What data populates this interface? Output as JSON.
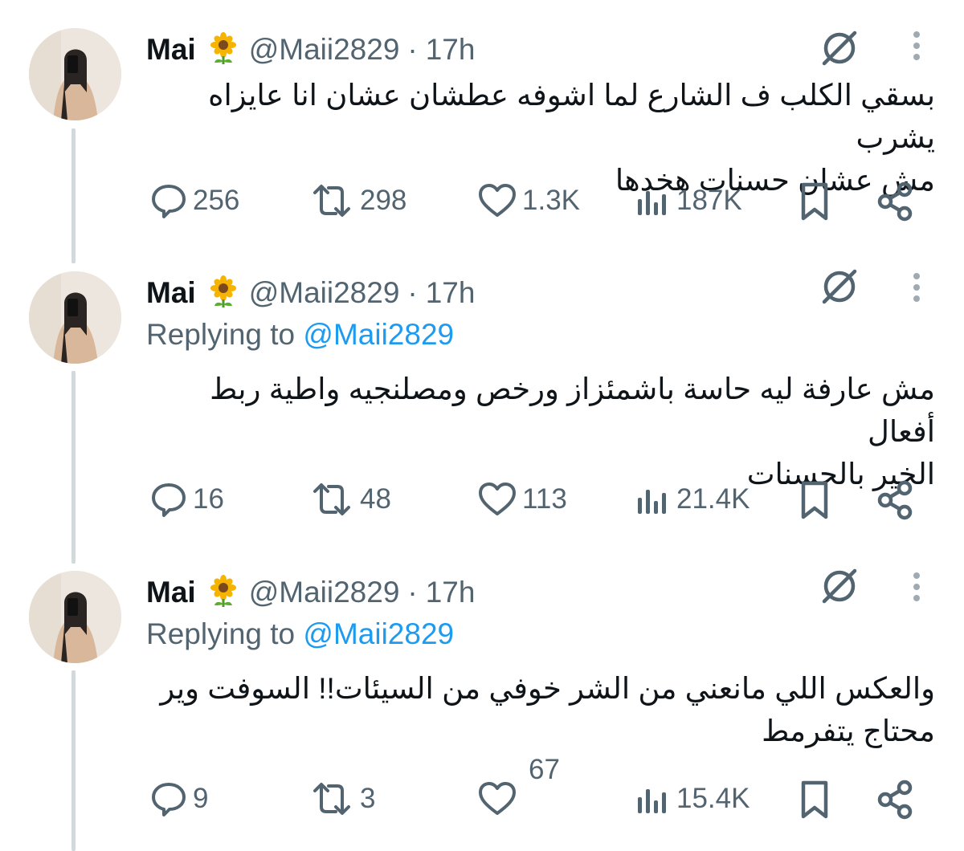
{
  "tweets": [
    {
      "name": "Mai",
      "handle": "@Maii2829",
      "separator": "·",
      "time": "17h",
      "replying_label": "",
      "replying_to": "",
      "lines": [
        "بسقي الكلب ف الشارع لما اشوفه عطشان عشان انا عايزاه يشرب",
        "مش عشان حسنات هخدها"
      ],
      "replies": "256",
      "reposts": "298",
      "likes": "1.3K",
      "views": "187K"
    },
    {
      "name": "Mai",
      "handle": "@Maii2829",
      "separator": "·",
      "time": "17h",
      "replying_label": "Replying to",
      "replying_to": "@Maii2829",
      "lines": [
        "مش عارفة ليه حاسة باشمئزاز ورخص ومصلنجيه واطية ربط أفعال",
        "الخير بالحسنات"
      ],
      "replies": "16",
      "reposts": "48",
      "likes": "113",
      "views": "21.4K"
    },
    {
      "name": "Mai",
      "handle": "@Maii2829",
      "separator": "·",
      "time": "17h",
      "replying_label": "Replying to",
      "replying_to": "@Maii2829",
      "lines": [
        "والعكس اللي مانعني من الشر خوفي من السيئات!! السوفت وير",
        "محتاج يتفرمط"
      ],
      "replies": "9",
      "reposts": "3",
      "likes": "67",
      "views": "15.4K"
    }
  ],
  "icons": {
    "sunflower": "sunflower-emoji",
    "grok": "grok-icon",
    "more": "more-icon",
    "reply": "reply-icon",
    "repost": "repost-icon",
    "like": "like-icon",
    "views": "views-icon",
    "bookmark": "bookmark-icon",
    "share": "share-icon"
  },
  "colors": {
    "text": "#0f1419",
    "secondary": "#536471",
    "link": "#1d9bf0",
    "thread_line": "#cfd9de"
  }
}
